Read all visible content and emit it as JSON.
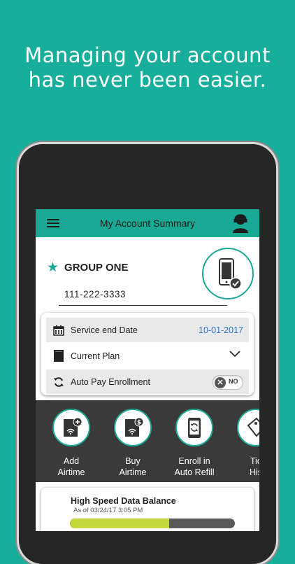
{
  "headline": {
    "line1": "Managing your account",
    "line2": "has never been easier."
  },
  "app_bar": {
    "title": "My Account Summary",
    "menu_icon": "hamburger-menu-icon",
    "support_icon": "customer-support-icon"
  },
  "account": {
    "name": "GROUP ONE",
    "phone_number": "111-222-3333",
    "device_icon": "smartphone-check-icon"
  },
  "details": {
    "service_end_label": "Service end Date",
    "service_end_value": "10-01-2017",
    "current_plan_label": "Current Plan",
    "auto_pay_label": "Auto Pay Enrollment",
    "auto_pay_state": "NO"
  },
  "actions": [
    {
      "line1": "Add",
      "line2": "Airtime"
    },
    {
      "line1": "Buy",
      "line2": "Airtime"
    },
    {
      "line1": "Enroll in",
      "line2": "Auto Refill"
    },
    {
      "line1": "Tic",
      "line2": "His"
    }
  ],
  "balance": {
    "title": "High Speed Data Balance",
    "as_of": "As of 03/24/17 3:05 PM",
    "fraction_used": 0.6
  },
  "colors": {
    "brand_teal": "#19a995",
    "background": "#17ae9b",
    "link_blue": "#2b73c8",
    "balance_green": "#c3d63a"
  }
}
